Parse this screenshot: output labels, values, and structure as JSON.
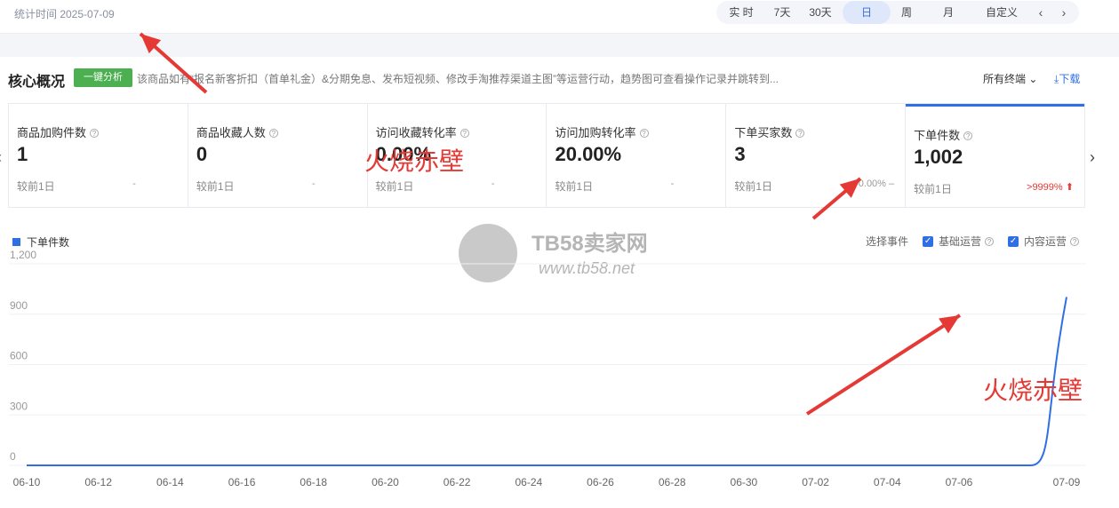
{
  "header": {
    "stat_time": "统计时间 2025-07-09",
    "range_tabs": [
      "实 时",
      "7天",
      "30天",
      "日",
      "周",
      "月",
      "自定义"
    ],
    "active_tab": "日",
    "prev": "‹",
    "next": "›"
  },
  "overview": {
    "title": "核心概况",
    "analyze_button": "一键分析",
    "description": "该商品如有“报名新客折扣（首单礼金）&分期免息、发布短视频、修改手淘推荐渠道主图”等运营行动，趋势图可查看操作记录并跳转到...",
    "terminal": "所有终端",
    "download": "下载"
  },
  "cards": [
    {
      "label": "商品加购件数",
      "value": "1",
      "compare": "较前1日",
      "change": "-"
    },
    {
      "label": "商品收藏人数",
      "value": "0",
      "compare": "较前1日",
      "change": "-"
    },
    {
      "label": "访问收藏转化率",
      "value": "0.00%",
      "compare": "较前1日",
      "change": "-"
    },
    {
      "label": "访问加购转化率",
      "value": "20.00%",
      "compare": "较前1日",
      "change": "-"
    },
    {
      "label": "下单买家数",
      "value": "3",
      "compare": "较前1日",
      "change": "0.00% –"
    },
    {
      "label": "下单件数",
      "value": "1,002",
      "compare": "较前1日",
      "change": ">9999% ⬆"
    }
  ],
  "events": {
    "label": "选择事件",
    "options": [
      "基础运营",
      "内容运营"
    ]
  },
  "watermark": {
    "name": "TB58卖家网",
    "url": "www.tb58.net"
  },
  "annotations": [
    "火烧赤壁",
    "火烧赤壁"
  ],
  "colors": {
    "accent": "#2f6fe4",
    "green": "#4cb050",
    "annotation": "#e53935"
  },
  "chart_data": {
    "type": "line",
    "series": [
      {
        "name": "下单件数",
        "x": [
          "06-10",
          "06-11",
          "06-12",
          "06-13",
          "06-14",
          "06-15",
          "06-16",
          "06-17",
          "06-18",
          "06-19",
          "06-20",
          "06-21",
          "06-22",
          "06-23",
          "06-24",
          "06-25",
          "06-26",
          "06-27",
          "06-28",
          "06-29",
          "06-30",
          "07-01",
          "07-02",
          "07-03",
          "07-04",
          "07-05",
          "07-06",
          "07-07",
          "07-08",
          "07-09"
        ],
        "values": [
          0,
          0,
          0,
          0,
          0,
          0,
          0,
          0,
          0,
          0,
          0,
          0,
          0,
          0,
          0,
          0,
          0,
          0,
          0,
          0,
          0,
          0,
          0,
          0,
          0,
          0,
          0,
          0,
          0,
          1002
        ]
      }
    ],
    "x_ticks": [
      "06-10",
      "06-12",
      "06-14",
      "06-16",
      "06-18",
      "06-20",
      "06-22",
      "06-24",
      "06-26",
      "06-28",
      "06-30",
      "07-02",
      "07-04",
      "07-06",
      "07-09"
    ],
    "y_ticks": [
      1200,
      900,
      600,
      300,
      0
    ],
    "ylim": [
      0,
      1200
    ],
    "grid": true,
    "legend": "top-left"
  }
}
